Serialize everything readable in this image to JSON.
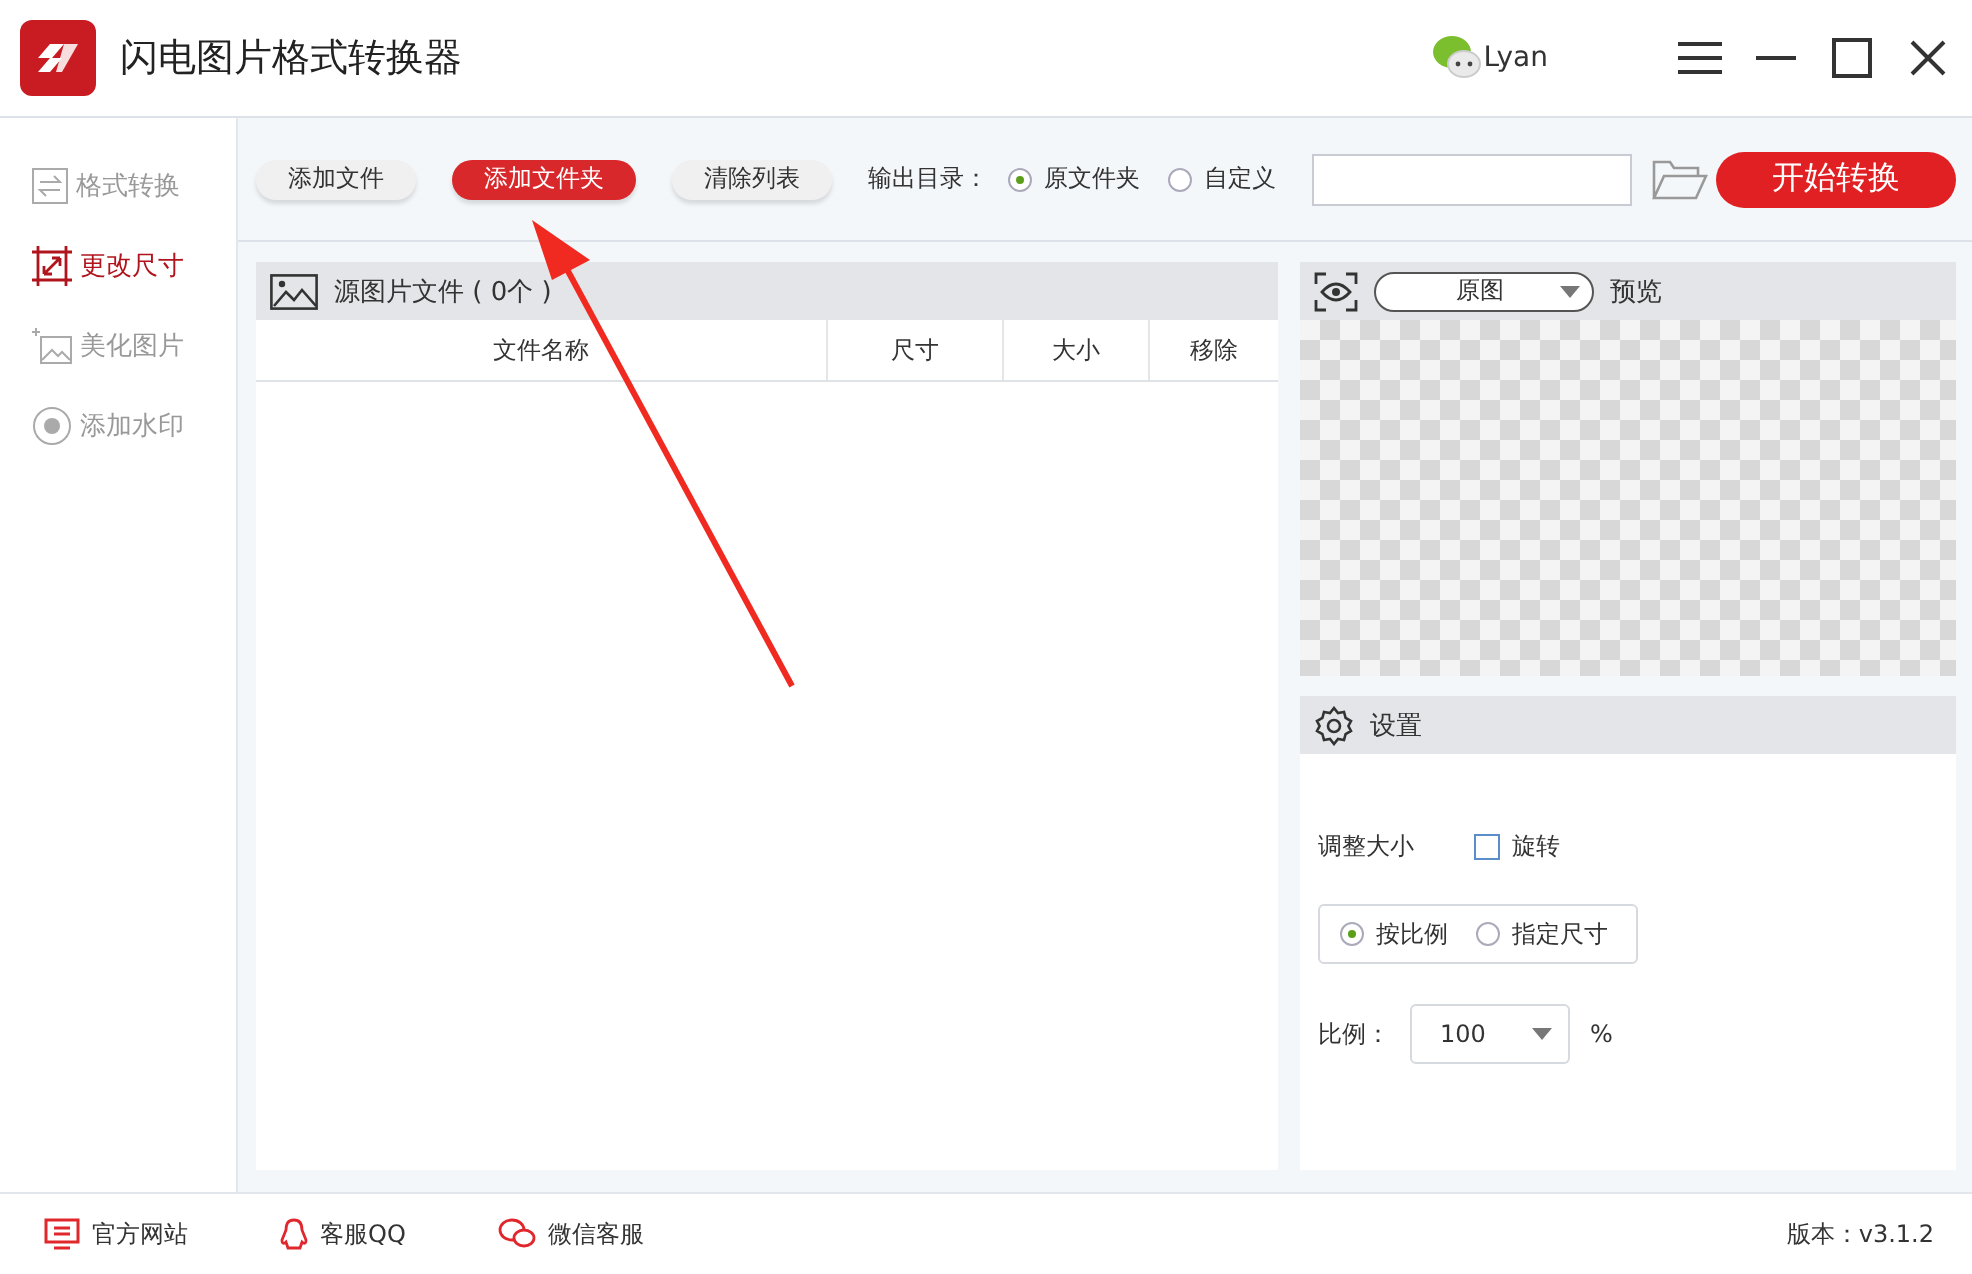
{
  "window": {
    "title": "闪电图片格式转换器",
    "user": "Lyan"
  },
  "toolbar": {
    "buttons": [
      {
        "label": "添加文件",
        "primary": false
      },
      {
        "label": "添加文件夹",
        "primary": true
      },
      {
        "label": "清除列表",
        "primary": false
      }
    ],
    "output_label": "输出目录：",
    "output_options": [
      {
        "label": "原文件夹",
        "selected": true
      },
      {
        "label": "自定义",
        "selected": false
      }
    ],
    "start_button": "开始转换"
  },
  "sidebar": {
    "items": [
      {
        "label": "格式转换",
        "selected": false,
        "kind": "convert"
      },
      {
        "label": "更改尺寸",
        "selected": true,
        "kind": "resize"
      },
      {
        "label": "美化图片",
        "selected": false,
        "kind": "beautify"
      },
      {
        "label": "添加水印",
        "selected": false,
        "kind": "watermark"
      }
    ]
  },
  "file_panel": {
    "title": "源图片文件 ( 0个 )",
    "columns": [
      "文件名称",
      "尺寸",
      "大小",
      "移除"
    ]
  },
  "preview": {
    "mode": "原图",
    "label": "预览"
  },
  "settings": {
    "title": "设置",
    "resize_label": "调整大小",
    "rotate": {
      "label": "旋转",
      "checked": false
    },
    "modes": [
      {
        "label": "按比例",
        "selected": true
      },
      {
        "label": "指定尺寸",
        "selected": false
      }
    ],
    "ratio_label": "比例：",
    "ratio": "100",
    "unit": "%"
  },
  "footer": {
    "links": [
      {
        "label": "官方网站",
        "kind": "website"
      },
      {
        "label": "客服QQ",
        "kind": "qq"
      },
      {
        "label": "微信客服",
        "kind": "wechat"
      }
    ],
    "version": "版本：v3.1.2"
  }
}
